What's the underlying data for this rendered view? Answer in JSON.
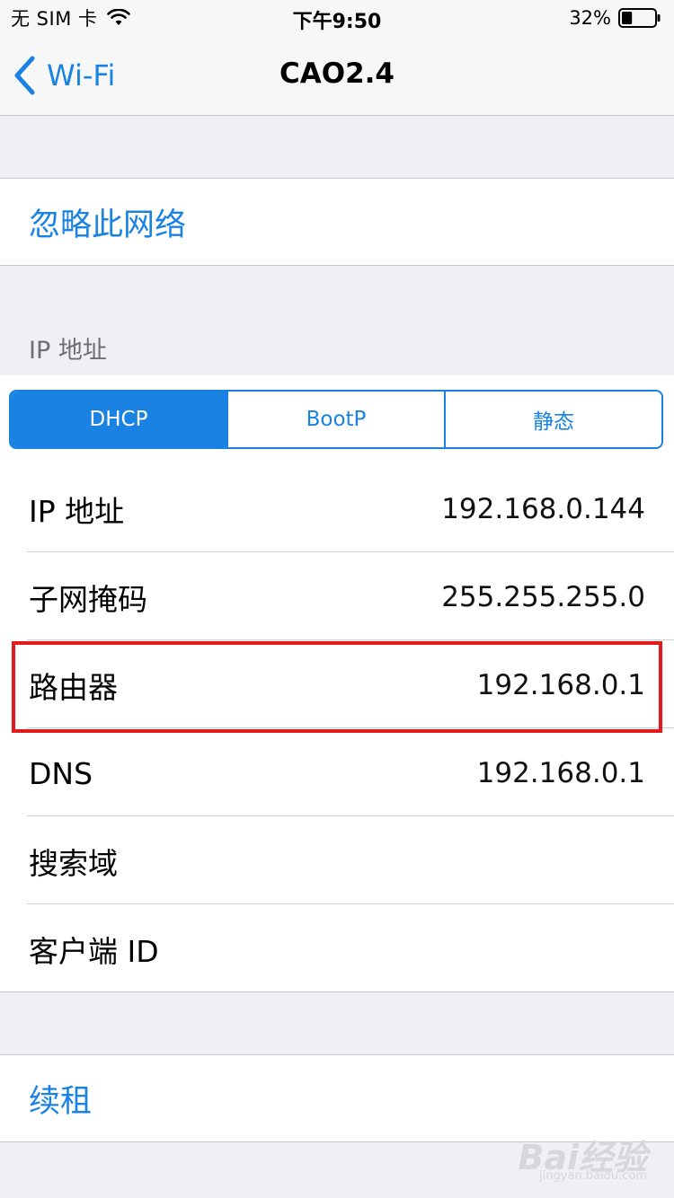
{
  "status": {
    "carrier": "无 SIM 卡",
    "time": "下午9:50",
    "battery": "32%",
    "battery_level": 0.32,
    "icons": [
      "wifi-icon",
      "battery-icon"
    ]
  },
  "nav": {
    "back_label": "Wi-Fi",
    "title": "CAO2.4"
  },
  "forget": {
    "label": "忽略此网络"
  },
  "ip_section": {
    "header": "IP 地址"
  },
  "segments": [
    {
      "label": "DHCP",
      "selected": true
    },
    {
      "label": "BootP",
      "selected": false
    },
    {
      "label": "静态",
      "selected": false
    }
  ],
  "rows": [
    {
      "label": "IP 地址",
      "value": "192.168.0.144"
    },
    {
      "label": "子网掩码",
      "value": "255.255.255.0"
    },
    {
      "label": "路由器",
      "value": "192.168.0.1"
    },
    {
      "label": "DNS",
      "value": "192.168.0.1"
    },
    {
      "label": "搜索域",
      "value": ""
    },
    {
      "label": "客户端 ID",
      "value": ""
    }
  ],
  "renew": {
    "label": "续租"
  },
  "watermark": {
    "text": "Bai经验",
    "sub": "jingyan.baidu.com"
  },
  "colors": {
    "accent": "#1a82e2",
    "highlight": "#e3191b",
    "background": "#efeff4"
  }
}
